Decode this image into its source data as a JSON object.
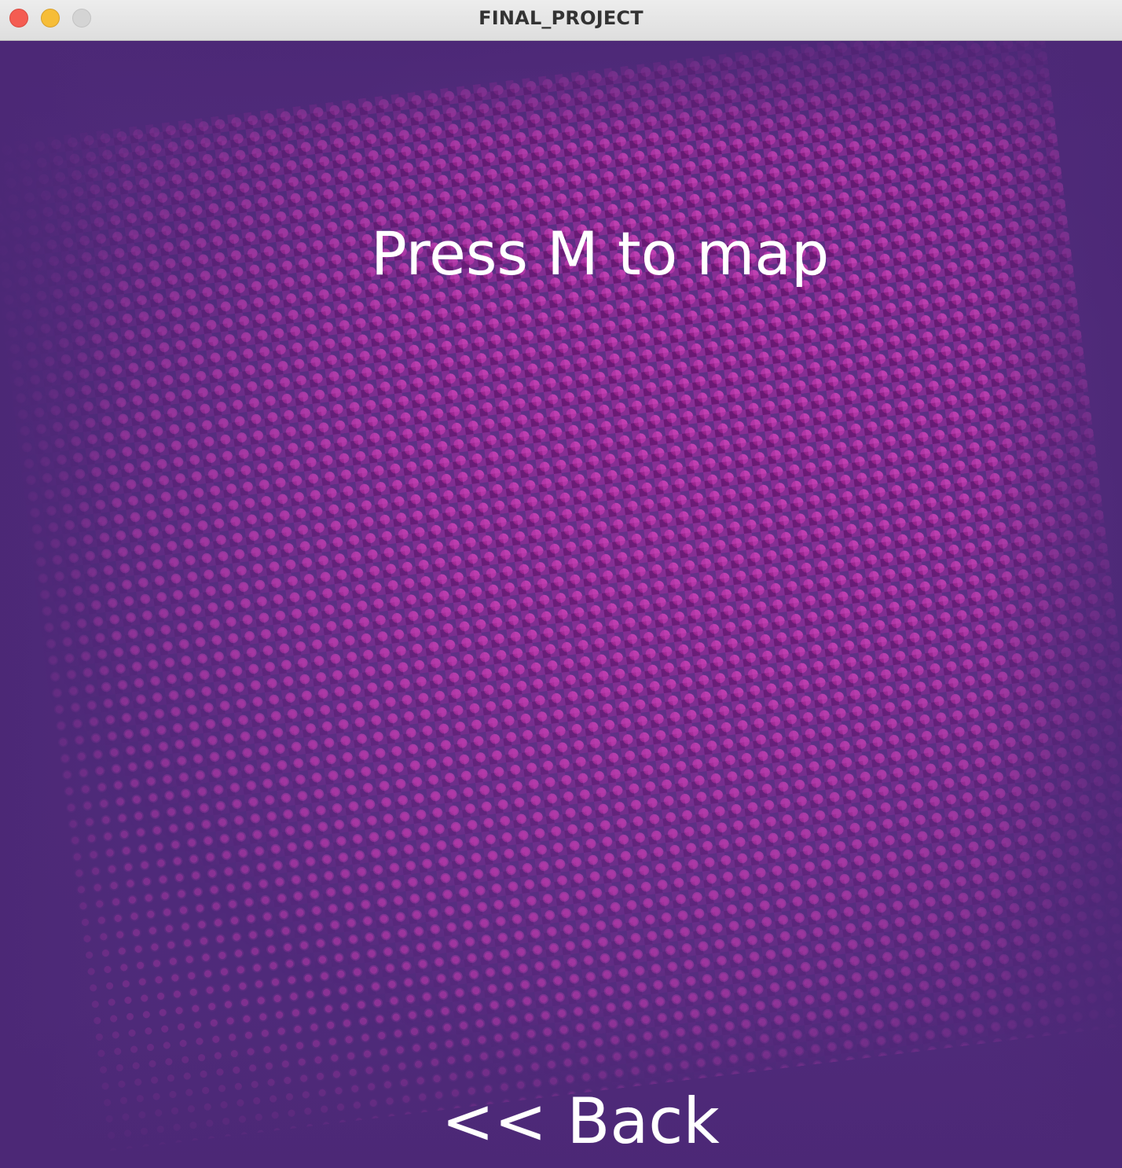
{
  "window": {
    "title": "FINAL_PROJECT"
  },
  "screen": {
    "instruction": "Press M to map",
    "back_label": "<< Back"
  },
  "colors": {
    "background": "#4d2a78",
    "halftone": "#b2379b",
    "text": "#ffffff",
    "titlebar": "#e6e6e6",
    "close": "#f45c52",
    "minimize": "#f6bd38",
    "zoom": "#d4d4d4"
  },
  "icons": [
    "close-window-icon",
    "minimize-window-icon",
    "zoom-window-icon"
  ]
}
